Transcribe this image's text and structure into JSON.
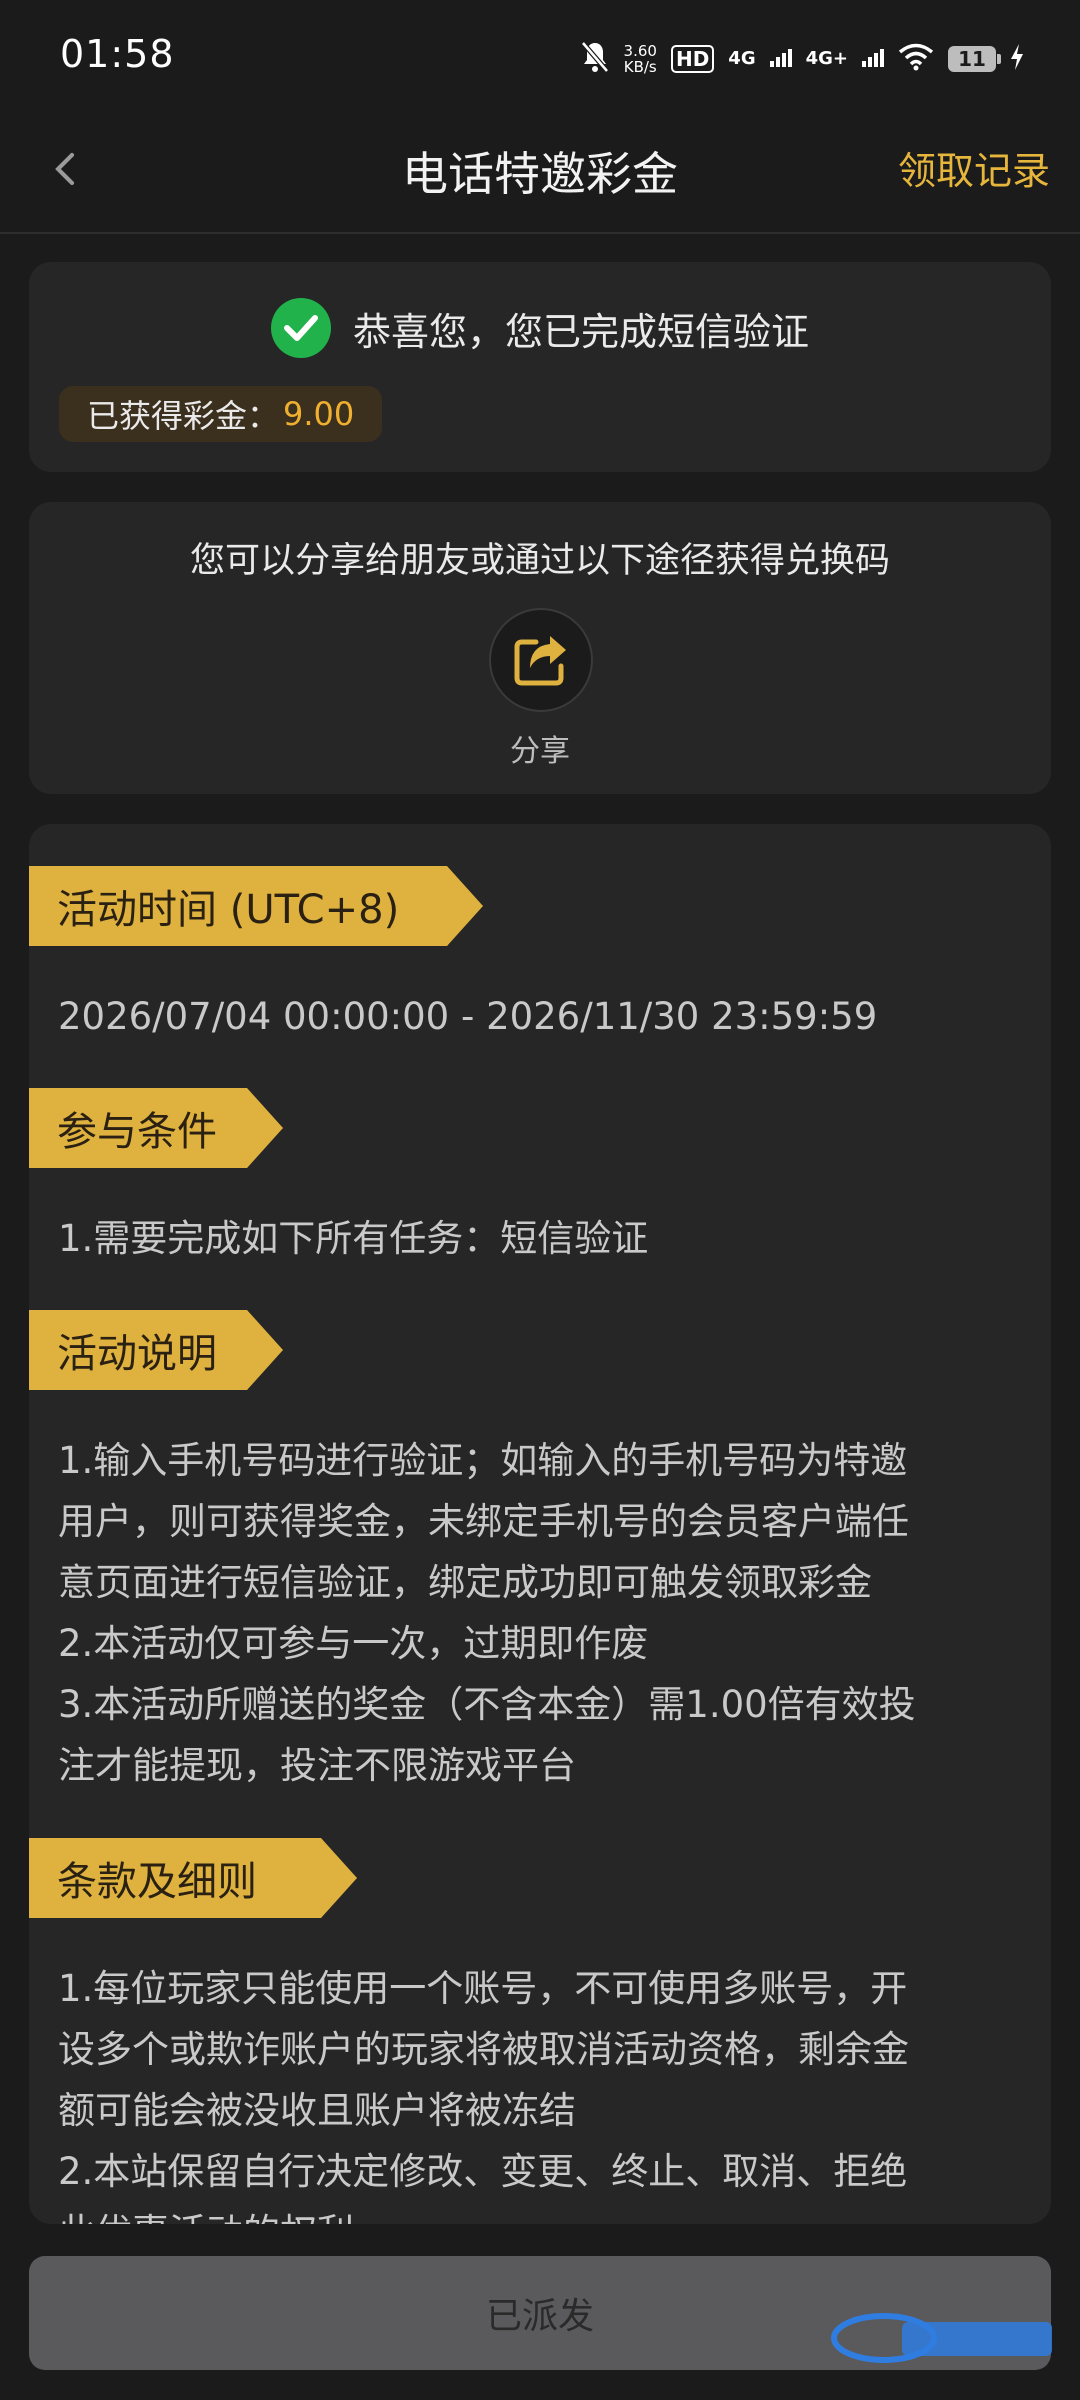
{
  "status_bar": {
    "time": "01:58",
    "net_speed_value": "3.60",
    "net_speed_unit": "KB/s",
    "hd_label": "HD",
    "net1": "4G",
    "net2": "4G+",
    "battery": "11"
  },
  "header": {
    "title": "电话特邀彩金",
    "record_link": "领取记录"
  },
  "verify_card": {
    "message": "恭喜您，您已完成短信验证",
    "bonus_label": "已获得彩金：",
    "bonus_value": "9.00"
  },
  "share_card": {
    "intro": "您可以分享给朋友或通过以下途径获得兑换码",
    "share_label": "分享"
  },
  "sections": [
    {
      "title": "活动时间 (UTC+8)",
      "lines": [
        "2026/07/04 00:00:00 - 2026/11/30 23:59:59"
      ]
    },
    {
      "title": "参与条件",
      "lines": [
        "1.需要完成如下所有任务：短信验证"
      ]
    },
    {
      "title": "活动说明",
      "lines": [
        "1.输入手机号码进行验证；如输入的手机号码为特邀",
        "用户，则可获得奖金，未绑定手机号的会员客户端任",
        "意页面进行短信验证，绑定成功即可触发领取彩金",
        "2.本活动仅可参与一次，过期即作废",
        "3.本活动所赠送的奖金（不含本金）需1.00倍有效投",
        "注才能提现，投注不限游戏平台"
      ]
    },
    {
      "title": "条款及细则",
      "lines": [
        "1.每位玩家只能使用一个账号，不可使用多账号，开",
        "设多个或欺诈账户的玩家将被取消活动资格，剩余金",
        "额可能会被没收且账户将被冻结",
        "2.本站保留自行决定修改、变更、终止、取消、拒绝",
        "此优惠活动的权利"
      ]
    }
  ],
  "footer": {
    "button_label": "已派发"
  },
  "colors": {
    "accent": "#e5b53c",
    "bonus": "#f0b02f",
    "success": "#22b24c",
    "background": "#1b1b1c",
    "card": "#262627"
  }
}
